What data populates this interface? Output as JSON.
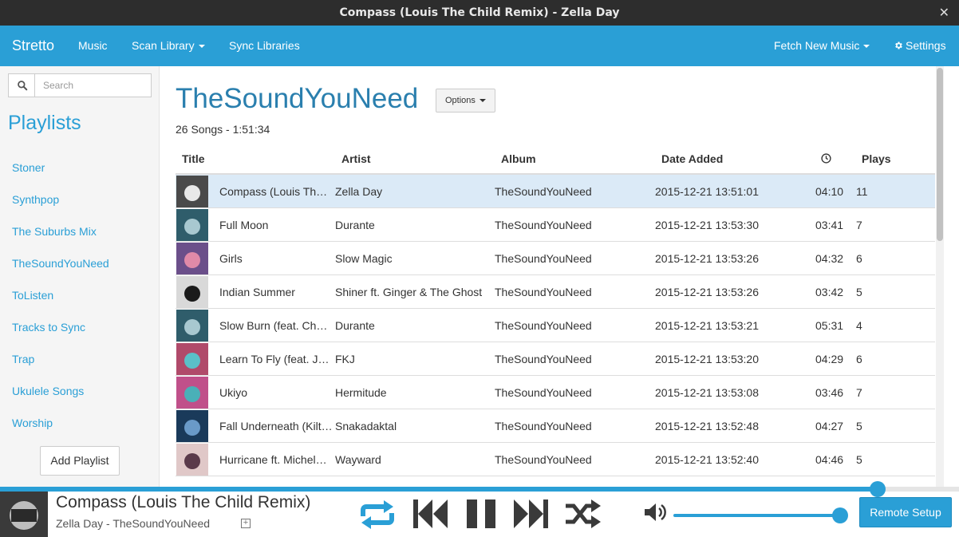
{
  "window": {
    "title": "Compass (Louis The Child Remix) - Zella Day",
    "close_glyph": "✕"
  },
  "navbar": {
    "brand": "Stretto",
    "music": "Music",
    "scan_library": "Scan Library",
    "sync_libraries": "Sync Libraries",
    "fetch_new_music": "Fetch New Music",
    "settings": "Settings"
  },
  "sidebar": {
    "search_placeholder": "Search",
    "heading": "Playlists",
    "playlists": [
      "Stoner",
      "Synthpop",
      "The Suburbs Mix",
      "TheSoundYouNeed",
      "ToListen",
      "Tracks to Sync",
      "Trap",
      "Ukulele Songs",
      "Worship"
    ],
    "add_playlist": "Add Playlist"
  },
  "main": {
    "title": "TheSoundYouNeed",
    "options": "Options",
    "song_count": "26 Songs - 1:51:34",
    "columns": {
      "title": "Title",
      "artist": "Artist",
      "album": "Album",
      "date_added": "Date Added",
      "duration_icon": "clock-icon",
      "plays": "Plays"
    },
    "songs": [
      {
        "title": "Compass (Louis The Child Remix)",
        "artist": "Zella Day",
        "album": "TheSoundYouNeed",
        "date_added": "2015-12-21 13:51:01",
        "duration": "04:10",
        "plays": "11",
        "active": true,
        "art": [
          "#4a4a4a",
          "#e8e8e8"
        ]
      },
      {
        "title": "Full Moon",
        "artist": "Durante",
        "album": "TheSoundYouNeed",
        "date_added": "2015-12-21 13:53:30",
        "duration": "03:41",
        "plays": "7",
        "art": [
          "#2f5d6b",
          "#a8c8d0"
        ]
      },
      {
        "title": "Girls",
        "artist": "Slow Magic",
        "album": "TheSoundYouNeed",
        "date_added": "2015-12-21 13:53:26",
        "duration": "04:32",
        "plays": "6",
        "art": [
          "#6b4f8a",
          "#e08aa8"
        ]
      },
      {
        "title": "Indian Summer",
        "artist": "Shiner ft. Ginger & The Ghost",
        "album": "TheSoundYouNeed",
        "date_added": "2015-12-21 13:53:26",
        "duration": "03:42",
        "plays": "5",
        "art": [
          "#d9d9d9",
          "#1a1a1a"
        ]
      },
      {
        "title": "Slow Burn (feat. Chunky)",
        "artist": "Durante",
        "album": "TheSoundYouNeed",
        "date_added": "2015-12-21 13:53:21",
        "duration": "05:31",
        "plays": "4",
        "art": [
          "#2f5d6b",
          "#a8c8d0"
        ]
      },
      {
        "title": "Learn To Fly (feat. Jordan)",
        "artist": "FKJ",
        "album": "TheSoundYouNeed",
        "date_added": "2015-12-21 13:53:20",
        "duration": "04:29",
        "plays": "6",
        "art": [
          "#b04a6a",
          "#5ac0c8"
        ]
      },
      {
        "title": "Ukiyo",
        "artist": "Hermitude",
        "album": "TheSoundYouNeed",
        "date_added": "2015-12-21 13:53:08",
        "duration": "03:46",
        "plays": "7",
        "art": [
          "#c0508a",
          "#4ab0b8"
        ]
      },
      {
        "title": "Fall Underneath (Kilter Remix)",
        "artist": "Snakadaktal",
        "album": "TheSoundYouNeed",
        "date_added": "2015-12-21 13:52:48",
        "duration": "04:27",
        "plays": "5",
        "art": [
          "#1a3a5a",
          "#6a9ac8"
        ]
      },
      {
        "title": "Hurricane ft. Michele Miramontes",
        "artist": "Wayward",
        "album": "TheSoundYouNeed",
        "date_added": "2015-12-21 13:52:40",
        "duration": "04:46",
        "plays": "5",
        "art": [
          "#e0c8c8",
          "#5a3a4a"
        ]
      }
    ]
  },
  "player": {
    "title": "Compass (Louis The Child Remix)",
    "subtitle": "Zella Day - TheSoundYouNeed",
    "plus_glyph": "+",
    "progress": 0.915,
    "volume": 0.95,
    "remote_setup": "Remote Setup",
    "accent": "#2a9fd6"
  }
}
